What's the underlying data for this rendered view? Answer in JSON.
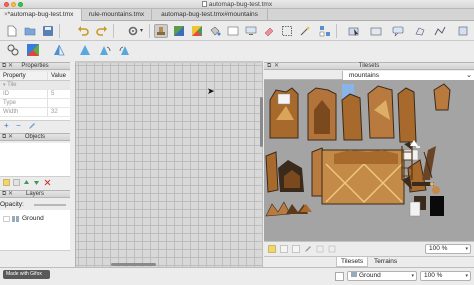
{
  "window": {
    "title": "automap-bug-test.tmx"
  },
  "tabs": [
    {
      "label": "*automap-bug-test.tmx",
      "close": "×"
    },
    {
      "label": "rule-mountains.tmx"
    },
    {
      "label": "automap-bug-test.tmx#mountains"
    }
  ],
  "properties_panel": {
    "title": "Properties",
    "columns": [
      "Property",
      "Value"
    ],
    "group": "Tile",
    "rows": [
      {
        "key": "ID",
        "value": "5"
      },
      {
        "key": "Type",
        "value": ""
      },
      {
        "key": "Width",
        "value": "32"
      }
    ],
    "add_symbol": "+",
    "remove_symbol": "−"
  },
  "objects_panel": {
    "title": "Objects"
  },
  "layers_panel": {
    "title": "Layers",
    "opacity_label": "Opacity:",
    "layers": [
      {
        "name": "Ground"
      }
    ]
  },
  "tilesets_panel": {
    "title": "Tilesets",
    "active_tileset": "mountains",
    "zoom": "100 %",
    "bottom_tabs": [
      "Tilesets",
      "Terrains"
    ]
  },
  "statusbar": {
    "layer_select": "Ground",
    "zoom": "100 %",
    "watermark": "Made with Gifox"
  },
  "colors": {
    "tileset_bg": "#a4a4a4",
    "canvas_bg": "#d8d8d8",
    "mountain_brown": "#a86a2c",
    "mountain_dark": "#3a2a1c",
    "selected_tile": "#8ab4e8"
  },
  "icons": [
    "new-file-icon",
    "open-folder-icon",
    "save-icon",
    "undo-icon",
    "redo-icon",
    "stamp-brush-icon",
    "terrain-brush-icon",
    "bucket-fill-icon",
    "eraser-icon",
    "rect-select-icon",
    "magic-wand-icon",
    "select-same-tile-icon",
    "object-select-icon",
    "rectangle-icon",
    "ellipse-icon",
    "polygon-icon",
    "polyline-icon",
    "tile-object-icon",
    "text-icon",
    "random-mode-icon",
    "wang-icon",
    "flip-horizontal-icon",
    "flip-vertical-icon",
    "rotate-left-icon",
    "rotate-right-icon"
  ]
}
